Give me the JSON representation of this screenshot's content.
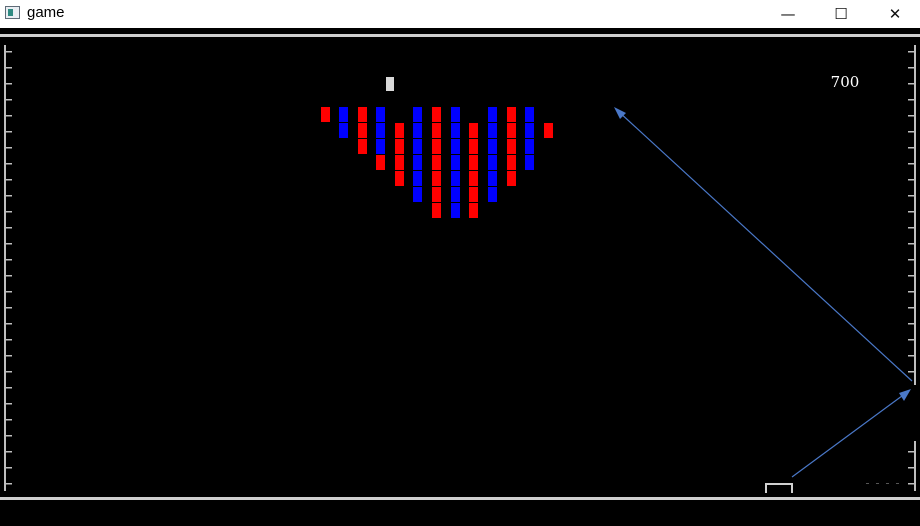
{
  "window": {
    "title": "game",
    "minimize_glyph": "—",
    "maximize_glyph": "☐",
    "close_glyph": "✕"
  },
  "game": {
    "score": "700",
    "colors": {
      "background": "#000000",
      "red_block": "#ff0000",
      "blue_block": "#0000ff",
      "ball": "#d9d9d9",
      "wall": "#bfbfbf",
      "trajectory": "#4a78c8",
      "score_text": "#ffffff"
    }
  }
}
